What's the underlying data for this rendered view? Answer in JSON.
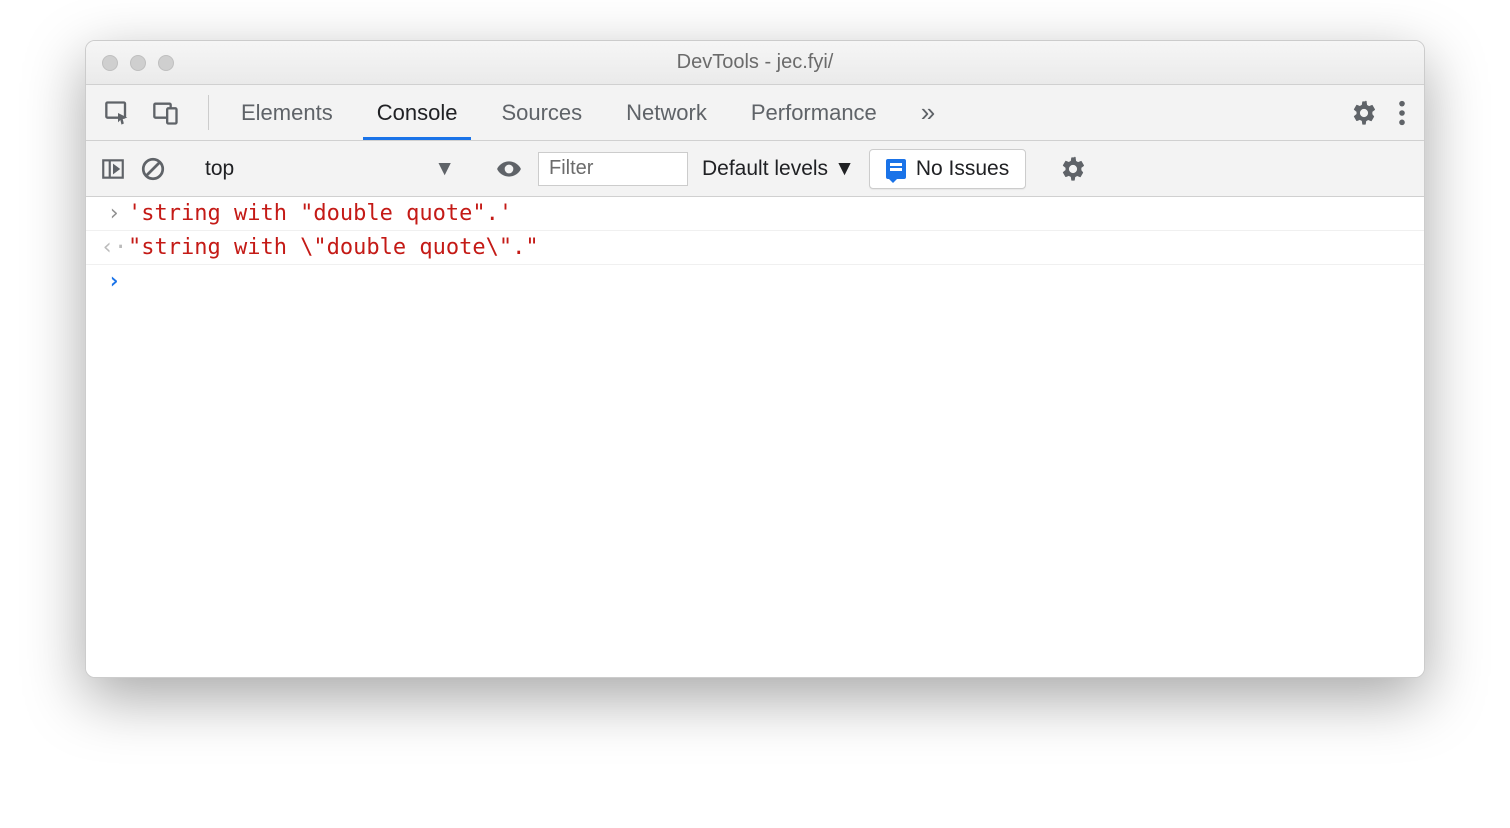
{
  "window": {
    "title": "DevTools - jec.fyi/"
  },
  "tabs": {
    "items": [
      "Elements",
      "Console",
      "Sources",
      "Network",
      "Performance"
    ],
    "active_index": 1,
    "overflow_glyph": "»"
  },
  "console_toolbar": {
    "context": "top",
    "filter_placeholder": "Filter",
    "levels_label": "Default levels",
    "issues_label": "No Issues"
  },
  "console_lines": [
    {
      "kind": "input",
      "gutter": "›",
      "text": "'string with \"double quote\".'"
    },
    {
      "kind": "output",
      "gutter": "‹·",
      "text": "\"string with \\\"double quote\\\".\""
    },
    {
      "kind": "prompt",
      "gutter": "›",
      "text": ""
    }
  ]
}
